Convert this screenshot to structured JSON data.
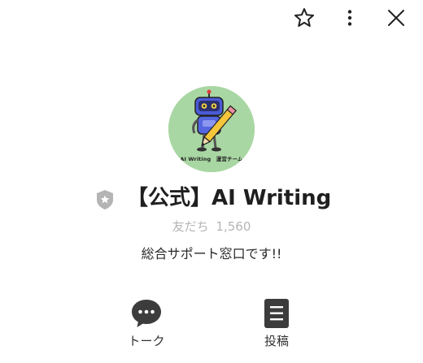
{
  "header": {
    "icons": [
      "star-icon",
      "more-vertical-icon",
      "close-icon"
    ]
  },
  "profile": {
    "logo_text": "AI Writing　運営チーム",
    "name": "【公式】AI Writing",
    "friends_label": "友だち",
    "friends_count": "1,560",
    "status_message": "総合サポート窓口です!!"
  },
  "actions": [
    {
      "label": "トーク",
      "icon": "chat-bubble-icon"
    },
    {
      "label": "投稿",
      "icon": "document-icon"
    }
  ],
  "colors": {
    "avatar_bg": "#a9d7a3",
    "shield": "#b4b4b4",
    "icon_dark": "#3c3c3c",
    "muted_text": "#b5b5b5"
  }
}
